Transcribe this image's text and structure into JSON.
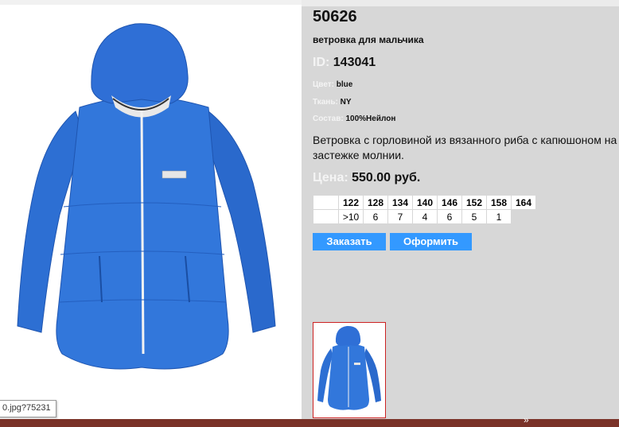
{
  "tooltip": "0.jpg?75231",
  "product": {
    "article": "50626",
    "name": "ветровка для мальчика",
    "id_label": "ID:",
    "id_value": "143041",
    "color_label": "Цвет:",
    "color_value": "blue",
    "fabric_label": "Ткань:",
    "fabric_value": "NY",
    "composition_label": "Состав:",
    "composition_value": "100%Нейлон",
    "description": "Ветровка с горловиной из вязанного риба с капюшоном на застежке молнии.",
    "price_label": "Цена:",
    "price_value": "550.00 руб."
  },
  "sizes": {
    "headers": [
      "",
      "122",
      "128",
      "134",
      "140",
      "146",
      "152",
      "158",
      "164"
    ],
    "counts": [
      "",
      ">10",
      "6",
      "7",
      "4",
      "6",
      "5",
      "1",
      ""
    ]
  },
  "buttons": {
    "order": "Заказать",
    "checkout": "Оформить"
  },
  "colors": {
    "jacket_blue": "#2f6fd6",
    "button_blue": "#3399ff",
    "thumb_border": "#cc2222",
    "bottom_bar": "#7a3228"
  },
  "footer_glyph": "»"
}
